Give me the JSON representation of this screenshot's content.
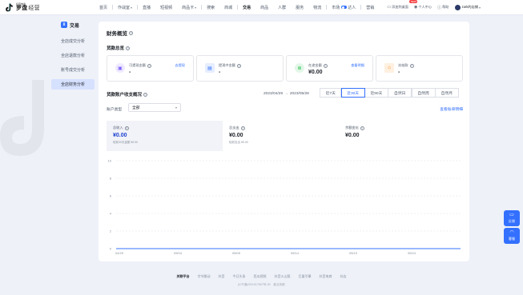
{
  "header": {
    "logo_small": "抖音电商",
    "logo_main": "罗盘",
    "logo_sub": "经营",
    "nav": [
      {
        "label": "首页"
      },
      {
        "label": "作战室",
        "caret": true
      },
      {
        "label": "直播"
      },
      {
        "label": "短视频"
      },
      {
        "label": "商品卡",
        "caret": true
      },
      {
        "label": "搜索"
      },
      {
        "label": "商城"
      },
      {
        "label": "交易",
        "active": true
      },
      {
        "label": "商品"
      },
      {
        "label": "人群"
      },
      {
        "label": "服务"
      },
      {
        "label": "物流"
      },
      {
        "label": "市场",
        "toggle": true,
        "after": "达人"
      },
      {
        "label": "营销"
      }
    ],
    "tools": {
      "shop_entry": "添加到桌面",
      "badge": "NEW",
      "personal": "个人中心",
      "help": "帮助",
      "user": "zark的店铺"
    }
  },
  "sidebar": {
    "title": "交易",
    "items": [
      {
        "label": "全店成交分析"
      },
      {
        "label": "全店退款分析"
      },
      {
        "label": "账号成交分析"
      },
      {
        "label": "全店财务分析",
        "active": true
      }
    ]
  },
  "main": {
    "title": "财务概览",
    "overview_title": "货款总览",
    "boxes": [
      {
        "label": "可提现金额",
        "link": "去提现",
        "value": "-",
        "icon": "wallet-icon",
        "icon_color": "#7c5cff",
        "icon_bg": "#efeaff"
      },
      {
        "label": "提现中金额",
        "link": "",
        "value": "-",
        "icon": "clock-icon",
        "icon_color": "#3370ff",
        "icon_bg": "#e6eeff"
      },
      {
        "label": "在途金额",
        "link": "查看明细",
        "value": "¥0.00",
        "icon": "transit-icon",
        "icon_color": "#00b42a",
        "icon_bg": "#e3f7e8"
      },
      {
        "label": "冻结款",
        "link": "",
        "value": "-",
        "icon": "lock-icon",
        "icon_color": "#ff7d00",
        "icon_bg": "#fff0e0"
      }
    ],
    "account_title": "货款账户收支概况",
    "date_start": "2023/04/29",
    "date_end": "2023/05/28",
    "date_sep": "→",
    "periods": [
      {
        "label": "近7天"
      },
      {
        "label": "近30天",
        "active": true
      },
      {
        "label": "近90天"
      },
      {
        "label": "自然日"
      },
      {
        "label": "自然周"
      },
      {
        "label": "自然月"
      }
    ],
    "account_type_label": "账户类型",
    "account_type_value": "全部",
    "detail_link": "查看账单明细",
    "stats": [
      {
        "label": "总收入",
        "value": "¥0.00",
        "sub": "较前30天金额 ¥0.00",
        "active": true
      },
      {
        "label": "总支出",
        "value": "¥0.00",
        "sub": "较前支出 ¥0.00"
      },
      {
        "label": "余额变化",
        "value": "¥0.00",
        "sub": ""
      }
    ]
  },
  "chart_data": {
    "type": "line",
    "x": [
      "04/29",
      "05/04",
      "05/09",
      "05/14",
      "05/19",
      "05/24"
    ],
    "y_ticks": [
      0,
      2,
      4,
      6,
      8,
      10
    ],
    "ylim": [
      0,
      10
    ],
    "grid": true,
    "series": [
      {
        "values": [
          0,
          0,
          0,
          0,
          0,
          0
        ],
        "color": "#3370ff"
      }
    ]
  },
  "footer": {
    "links": [
      "关联平台",
      "字节跳动",
      "抖音",
      "今日头条",
      "西瓜视频",
      "抖音火山版",
      "巨量引擎",
      "抖音电商",
      "抖店"
    ],
    "icp": "[ICP]备2021017807号-30　营业执照"
  },
  "float": {
    "feedback": "反馈",
    "service": "客服"
  }
}
